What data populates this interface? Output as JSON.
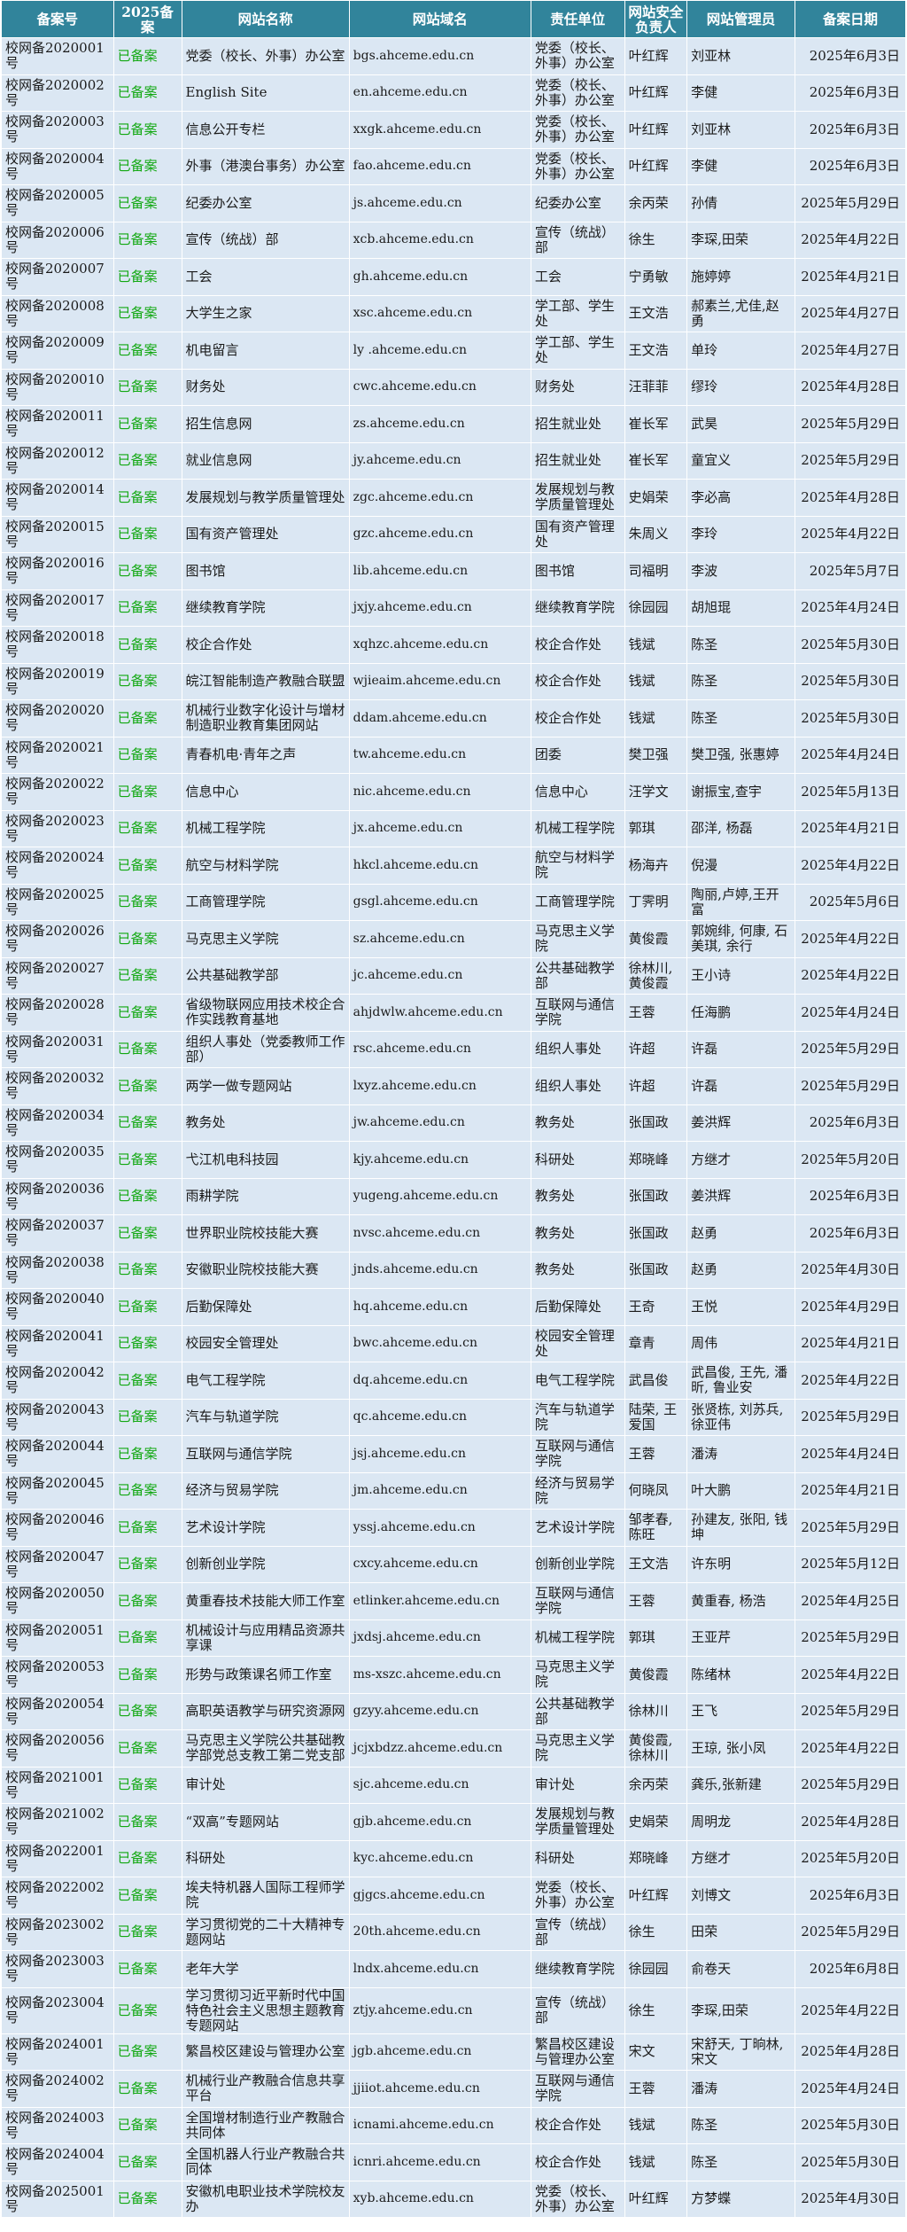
{
  "headers": [
    "备案号",
    "2025备案",
    "网站名称",
    "网站域名",
    "责任单位",
    "网站安全负责人",
    "网站管理员",
    "备案日期"
  ],
  "colors": {
    "header_bg": "#31849b",
    "row_bg": "#dbe7f3",
    "status": "#12a812"
  },
  "rows": [
    {
      "no": "校网备2020001号",
      "status": "已备案",
      "name": "党委（校长、外事）办公室",
      "domain": "bgs.ahceme.edu.cn",
      "unit": "党委（校长、外事）办公室",
      "owner": "叶红辉",
      "manager": "刘亚林",
      "date": "2025年6月3日"
    },
    {
      "no": "校网备2020002号",
      "status": "已备案",
      "name": "English Site",
      "domain": "en.ahceme.edu.cn",
      "unit": "党委（校长、外事）办公室",
      "owner": "叶红辉",
      "manager": "李健",
      "date": "2025年6月3日"
    },
    {
      "no": "校网备2020003号",
      "status": "已备案",
      "name": "信息公开专栏",
      "domain": "xxgk.ahceme.edu.cn",
      "unit": "党委（校长、外事）办公室",
      "owner": "叶红辉",
      "manager": "刘亚林",
      "date": "2025年6月3日"
    },
    {
      "no": "校网备2020004号",
      "status": "已备案",
      "name": "外事（港澳台事务）办公室",
      "domain": "fao.ahceme.edu.cn",
      "unit": "党委（校长、外事）办公室",
      "owner": "叶红辉",
      "manager": "李健",
      "date": "2025年6月3日"
    },
    {
      "no": "校网备2020005号",
      "status": "已备案",
      "name": "纪委办公室",
      "domain": "js.ahceme.edu.cn",
      "unit": "纪委办公室",
      "owner": "余丙荣",
      "manager": "孙倩",
      "date": "2025年5月29日"
    },
    {
      "no": "校网备2020006号",
      "status": "已备案",
      "name": "宣传（统战）部",
      "domain": "xcb.ahceme.edu.cn",
      "unit": "宣传（统战）部",
      "owner": "徐生",
      "manager": "李琛,田荣",
      "date": "2025年4月22日"
    },
    {
      "no": "校网备2020007号",
      "status": "已备案",
      "name": "工会",
      "domain": "gh.ahceme.edu.cn",
      "unit": "工会",
      "owner": "宁勇敏",
      "manager": "施婷婷",
      "date": "2025年4月21日"
    },
    {
      "no": "校网备2020008号",
      "status": "已备案",
      "name": "大学生之家",
      "domain": "xsc.ahceme.edu.cn",
      "unit": "学工部、学生处",
      "owner": "王文浩",
      "manager": "郝素兰,尤佳,赵勇",
      "date": "2025年4月27日"
    },
    {
      "no": "校网备2020009号",
      "status": "已备案",
      "name": "机电留言",
      "domain": "ly .ahceme.edu.cn",
      "unit": "学工部、学生处",
      "owner": "王文浩",
      "manager": "单玲",
      "date": "2025年4月27日"
    },
    {
      "no": "校网备2020010号",
      "status": "已备案",
      "name": "财务处",
      "domain": "cwc.ahceme.edu.cn",
      "unit": "财务处",
      "owner": "汪菲菲",
      "manager": "缪玲",
      "date": "2025年4月28日"
    },
    {
      "no": "校网备2020011号",
      "status": "已备案",
      "name": "招生信息网",
      "domain": "zs.ahceme.edu.cn",
      "unit": "招生就业处",
      "owner": "崔长军",
      "manager": "武昊",
      "date": "2025年5月29日"
    },
    {
      "no": "校网备2020012号",
      "status": "已备案",
      "name": "就业信息网",
      "domain": "jy.ahceme.edu.cn",
      "unit": "招生就业处",
      "owner": "崔长军",
      "manager": "童宜义",
      "date": "2025年5月29日"
    },
    {
      "no": "校网备2020014号",
      "status": "已备案",
      "name": "发展规划与教学质量管理处",
      "domain": "zgc.ahceme.edu.cn",
      "unit": "发展规划与教学质量管理处",
      "owner": "史娟荣",
      "manager": "李必高",
      "date": "2025年4月28日"
    },
    {
      "no": "校网备2020015号",
      "status": "已备案",
      "name": "国有资产管理处",
      "domain": "gzc.ahceme.edu.cn",
      "unit": "国有资产管理处",
      "owner": "朱周义",
      "manager": "李玲",
      "date": "2025年4月22日"
    },
    {
      "no": "校网备2020016号",
      "status": "已备案",
      "name": "图书馆",
      "domain": "lib.ahceme.edu.cn",
      "unit": "图书馆",
      "owner": "司福明",
      "manager": "李波",
      "date": "2025年5月7日"
    },
    {
      "no": "校网备2020017号",
      "status": "已备案",
      "name": "继续教育学院",
      "domain": "jxjy.ahceme.edu.cn",
      "unit": "继续教育学院",
      "owner": "徐园园",
      "manager": "胡旭琨",
      "date": "2025年4月24日"
    },
    {
      "no": "校网备2020018号",
      "status": "已备案",
      "name": "校企合作处",
      "domain": "xqhzc.ahceme.edu.cn",
      "unit": "校企合作处",
      "owner": "钱斌",
      "manager": "陈圣",
      "date": "2025年5月30日"
    },
    {
      "no": "校网备2020019号",
      "status": "已备案",
      "name": "皖江智能制造产教融合联盟",
      "domain": "wjieaim.ahceme.edu.cn",
      "unit": "校企合作处",
      "owner": "钱斌",
      "manager": "陈圣",
      "date": "2025年5月30日"
    },
    {
      "no": "校网备2020020号",
      "status": "已备案",
      "name": "机械行业数字化设计与增材制造职业教育集团网站",
      "domain": "ddam.ahceme.edu.cn",
      "unit": "校企合作处",
      "owner": "钱斌",
      "manager": "陈圣",
      "date": "2025年5月30日"
    },
    {
      "no": "校网备2020021号",
      "status": "已备案",
      "name": "青春机电·青年之声",
      "domain": "tw.ahceme.edu.cn",
      "unit": "团委",
      "owner": "樊卫强",
      "manager": "樊卫强, 张惠婷",
      "date": "2025年4月24日"
    },
    {
      "no": "校网备2020022号",
      "status": "已备案",
      "name": "信息中心",
      "domain": "nic.ahceme.edu.cn",
      "unit": "信息中心",
      "owner": "汪学文",
      "manager": "谢振宝,查宇",
      "date": "2025年5月13日"
    },
    {
      "no": "校网备2020023号",
      "status": "已备案",
      "name": "机械工程学院",
      "domain": "jx.ahceme.edu.cn",
      "unit": "机械工程学院",
      "owner": "郭琪",
      "manager": "邵洋, 杨磊",
      "date": "2025年4月21日"
    },
    {
      "no": "校网备2020024号",
      "status": "已备案",
      "name": "航空与材料学院",
      "domain": "hkcl.ahceme.edu.cn",
      "unit": "航空与材料学院",
      "owner": "杨海卉",
      "manager": "倪漫",
      "date": "2025年4月22日"
    },
    {
      "no": "校网备2020025号",
      "status": "已备案",
      "name": "工商管理学院",
      "domain": "gsgl.ahceme.edu.cn",
      "unit": "工商管理学院",
      "owner": "丁霁明",
      "manager": "陶丽,卢婷,王开富",
      "date": "2025年5月6日"
    },
    {
      "no": "校网备2020026号",
      "status": "已备案",
      "name": "马克思主义学院",
      "domain": "sz.ahceme.edu.cn",
      "unit": "马克思主义学院",
      "owner": "黄俊霞",
      "manager": "郭婉绯, 何康, 石美琪, 余行",
      "date": "2025年4月22日"
    },
    {
      "no": "校网备2020027号",
      "status": "已备案",
      "name": "公共基础教学部",
      "domain": "jc.ahceme.edu.cn",
      "unit": "公共基础教学部",
      "owner": "徐林川, 黄俊霞",
      "manager": "王小诗",
      "date": "2025年4月22日"
    },
    {
      "no": "校网备2020028号",
      "status": "已备案",
      "name": "省级物联网应用技术校企合作实践教育基地",
      "domain": "ahjdwlw.ahceme.edu.cn",
      "unit": "互联网与通信学院",
      "owner": "王蓉",
      "manager": "任海鹏",
      "date": "2025年4月24日"
    },
    {
      "no": "校网备2020031号",
      "status": "已备案",
      "name": "组织人事处（党委教师工作部）",
      "domain": "rsc.ahceme.edu.cn",
      "unit": "组织人事处",
      "owner": "许超",
      "manager": "许磊",
      "date": "2025年5月29日"
    },
    {
      "no": "校网备2020032号",
      "status": "已备案",
      "name": "两学一做专题网站",
      "domain": "lxyz.ahceme.edu.cn",
      "unit": "组织人事处",
      "owner": "许超",
      "manager": "许磊",
      "date": "2025年5月29日"
    },
    {
      "no": "校网备2020034号",
      "status": "已备案",
      "name": "教务处",
      "domain": "jw.ahceme.edu.cn",
      "unit": "教务处",
      "owner": "张国政",
      "manager": "姜洪辉",
      "date": "2025年6月3日"
    },
    {
      "no": "校网备2020035号",
      "status": "已备案",
      "name": "弋江机电科技园",
      "domain": "kjy.ahceme.edu.cn",
      "unit": "科研处",
      "owner": "郑晓峰",
      "manager": "方继才",
      "date": "2025年5月20日"
    },
    {
      "no": "校网备2020036号",
      "status": "已备案",
      "name": "雨耕学院",
      "domain": "yugeng.ahceme.edu.cn",
      "unit": "教务处",
      "owner": "张国政",
      "manager": "姜洪辉",
      "date": "2025年6月3日"
    },
    {
      "no": "校网备2020037号",
      "status": "已备案",
      "name": "世界职业院校技能大赛",
      "domain": "nvsc.ahceme.edu.cn",
      "unit": "教务处",
      "owner": "张国政",
      "manager": "赵勇",
      "date": "2025年6月3日"
    },
    {
      "no": "校网备2020038号",
      "status": "已备案",
      "name": "安徽职业院校技能大赛",
      "domain": "jnds.ahceme.edu.cn",
      "unit": "教务处",
      "owner": "张国政",
      "manager": "赵勇",
      "date": "2025年4月30日"
    },
    {
      "no": "校网备2020040号",
      "status": "已备案",
      "name": "后勤保障处",
      "domain": "hq.ahceme.edu.cn",
      "unit": "后勤保障处",
      "owner": "王奇",
      "manager": "王悦",
      "date": "2025年4月29日"
    },
    {
      "no": "校网备2020041号",
      "status": "已备案",
      "name": "校园安全管理处",
      "domain": "bwc.ahceme.edu.cn",
      "unit": "校园安全管理处",
      "owner": "章青",
      "manager": "周伟",
      "date": "2025年4月21日"
    },
    {
      "no": "校网备2020042号",
      "status": "已备案",
      "name": "电气工程学院",
      "domain": "dq.ahceme.edu.cn",
      "unit": "电气工程学院",
      "owner": "武昌俊",
      "manager": "武昌俊, 王先, 潘昕, 鲁业安",
      "date": "2025年4月22日"
    },
    {
      "no": "校网备2020043号",
      "status": "已备案",
      "name": "汽车与轨道学院",
      "domain": "qc.ahceme.edu.cn",
      "unit": "汽车与轨道学院",
      "owner": "陆荣, 王爱国",
      "manager": "张贤栋, 刘苏兵, 徐亚伟",
      "date": "2025年5月29日"
    },
    {
      "no": "校网备2020044号",
      "status": "已备案",
      "name": "互联网与通信学院",
      "domain": "jsj.ahceme.edu.cn",
      "unit": "互联网与通信学院",
      "owner": "王蓉",
      "manager": "潘涛",
      "date": "2025年4月24日"
    },
    {
      "no": "校网备2020045号",
      "status": "已备案",
      "name": "经济与贸易学院",
      "domain": "jm.ahceme.edu.cn",
      "unit": "经济与贸易学院",
      "owner": "何晓凤",
      "manager": "叶大鹏",
      "date": "2025年4月21日"
    },
    {
      "no": "校网备2020046号",
      "status": "已备案",
      "name": "艺术设计学院",
      "domain": "yssj.ahceme.edu.cn",
      "unit": "艺术设计学院",
      "owner": "邹孝春, 陈旺",
      "manager": "孙建友, 张阳, 钱坤",
      "date": "2025年5月29日"
    },
    {
      "no": "校网备2020047号",
      "status": "已备案",
      "name": "创新创业学院",
      "domain": "cxcy.ahceme.edu.cn",
      "unit": "创新创业学院",
      "owner": "王文浩",
      "manager": "许东明",
      "date": "2025年5月12日"
    },
    {
      "no": "校网备2020050号",
      "status": "已备案",
      "name": "黄重春技术技能大师工作室",
      "domain": "etlinker.ahceme.edu.cn",
      "unit": "互联网与通信学院",
      "owner": "王蓉",
      "manager": "黄重春, 杨浩",
      "date": "2025年4月25日"
    },
    {
      "no": "校网备2020051号",
      "status": "已备案",
      "name": "机械设计与应用精品资源共享课",
      "domain": "jxdsj.ahceme.edu.cn",
      "unit": "机械工程学院",
      "owner": "郭琪",
      "manager": "王亚芹",
      "date": "2025年5月29日"
    },
    {
      "no": "校网备2020053号",
      "status": "已备案",
      "name": "形势与政策课名师工作室",
      "domain": "ms-xszc.ahceme.edu.cn",
      "unit": "马克思主义学院",
      "owner": "黄俊霞",
      "manager": "陈绪林",
      "date": "2025年4月22日"
    },
    {
      "no": "校网备2020054号",
      "status": "已备案",
      "name": "高职英语教学与研究资源网",
      "domain": "gzyy.ahceme.edu.cn",
      "unit": "公共基础教学部",
      "owner": "徐林川",
      "manager": "王飞",
      "date": "2025年5月29日"
    },
    {
      "no": "校网备2020056号",
      "status": "已备案",
      "name": "马克思主义学院公共基础教学部党总支教工第二党支部",
      "domain": "jcjxbdzz.ahceme.edu.cn",
      "unit": "马克思主义学院",
      "owner": "黄俊霞, 徐林川",
      "manager": "王琼, 张小凤",
      "date": "2025年4月22日"
    },
    {
      "no": "校网备2021001号",
      "status": "已备案",
      "name": "审计处",
      "domain": "sjc.ahceme.edu.cn",
      "unit": "审计处",
      "owner": "余丙荣",
      "manager": "龚乐,张新建",
      "date": "2025年5月29日"
    },
    {
      "no": "校网备2021002号",
      "status": "已备案",
      "name": "“双高”专题网站",
      "domain": "gjb.ahceme.edu.cn",
      "unit": "发展规划与教学质量管理处",
      "owner": "史娟荣",
      "manager": "周明龙",
      "date": "2025年4月28日"
    },
    {
      "no": "校网备2022001号",
      "status": "已备案",
      "name": "科研处",
      "domain": "kyc.ahceme.edu.cn",
      "unit": "科研处",
      "owner": "郑晓峰",
      "manager": "方继才",
      "date": "2025年5月20日"
    },
    {
      "no": "校网备2022002号",
      "status": "已备案",
      "name": "埃夫特机器人国际工程师学院",
      "domain": "gjgcs.ahceme.edu.cn",
      "unit": "党委（校长、外事）办公室",
      "owner": "叶红辉",
      "manager": "刘博文",
      "date": "2025年6月3日"
    },
    {
      "no": "校网备2023002号",
      "status": "已备案",
      "name": "学习贯彻党的二十大精神专题网站",
      "domain": "20th.ahceme.edu.cn",
      "unit": "宣传（统战）部",
      "owner": "徐生",
      "manager": "田荣",
      "date": "2025年5月29日"
    },
    {
      "no": "校网备2023003号",
      "status": "已备案",
      "name": "老年大学",
      "domain": "lndx.ahceme.edu.cn",
      "unit": "继续教育学院",
      "owner": "徐园园",
      "manager": "俞卷天",
      "date": "2025年6月8日"
    },
    {
      "no": "校网备2023004号",
      "status": "已备案",
      "name": "学习贯彻习近平新时代中国特色社会主义思想主题教育专题网站",
      "domain": "ztjy.ahceme.edu.cn",
      "unit": "宣传（统战）部",
      "owner": "徐生",
      "manager": "李琛,田荣",
      "date": "2025年4月22日"
    },
    {
      "no": "校网备2024001号",
      "status": "已备案",
      "name": "繁昌校区建设与管理办公室",
      "domain": "jgb.ahceme.edu.cn",
      "unit": "繁昌校区建设与管理办公室",
      "owner": "宋文",
      "manager": "宋舒天, 丁晌林, 宋文",
      "date": "2025年4月28日"
    },
    {
      "no": "校网备2024002号",
      "status": "已备案",
      "name": "机械行业产教融合信息共享平台",
      "domain": "jjiiot.ahceme.edu.cn",
      "unit": "互联网与通信学院",
      "owner": "王蓉",
      "manager": "潘涛",
      "date": "2025年4月24日"
    },
    {
      "no": "校网备2024003号",
      "status": "已备案",
      "name": "全国增材制造行业产教融合共同体",
      "domain": "icnami.ahceme.edu.cn",
      "unit": "校企合作处",
      "owner": "钱斌",
      "manager": "陈圣",
      "date": "2025年5月30日"
    },
    {
      "no": "校网备2024004号",
      "status": "已备案",
      "name": "全国机器人行业产教融合共同体",
      "domain": "icnri.ahceme.edu.cn",
      "unit": "校企合作处",
      "owner": "钱斌",
      "manager": "陈圣",
      "date": "2025年5月30日"
    },
    {
      "no": "校网备2025001号",
      "status": "已备案",
      "name": "安徽机电职业技术学院校友办",
      "domain": "xyb.ahceme.edu.cn",
      "unit": "党委（校长、外事）办公室",
      "owner": "叶红辉",
      "manager": "方梦蝶",
      "date": "2025年4月30日"
    }
  ]
}
